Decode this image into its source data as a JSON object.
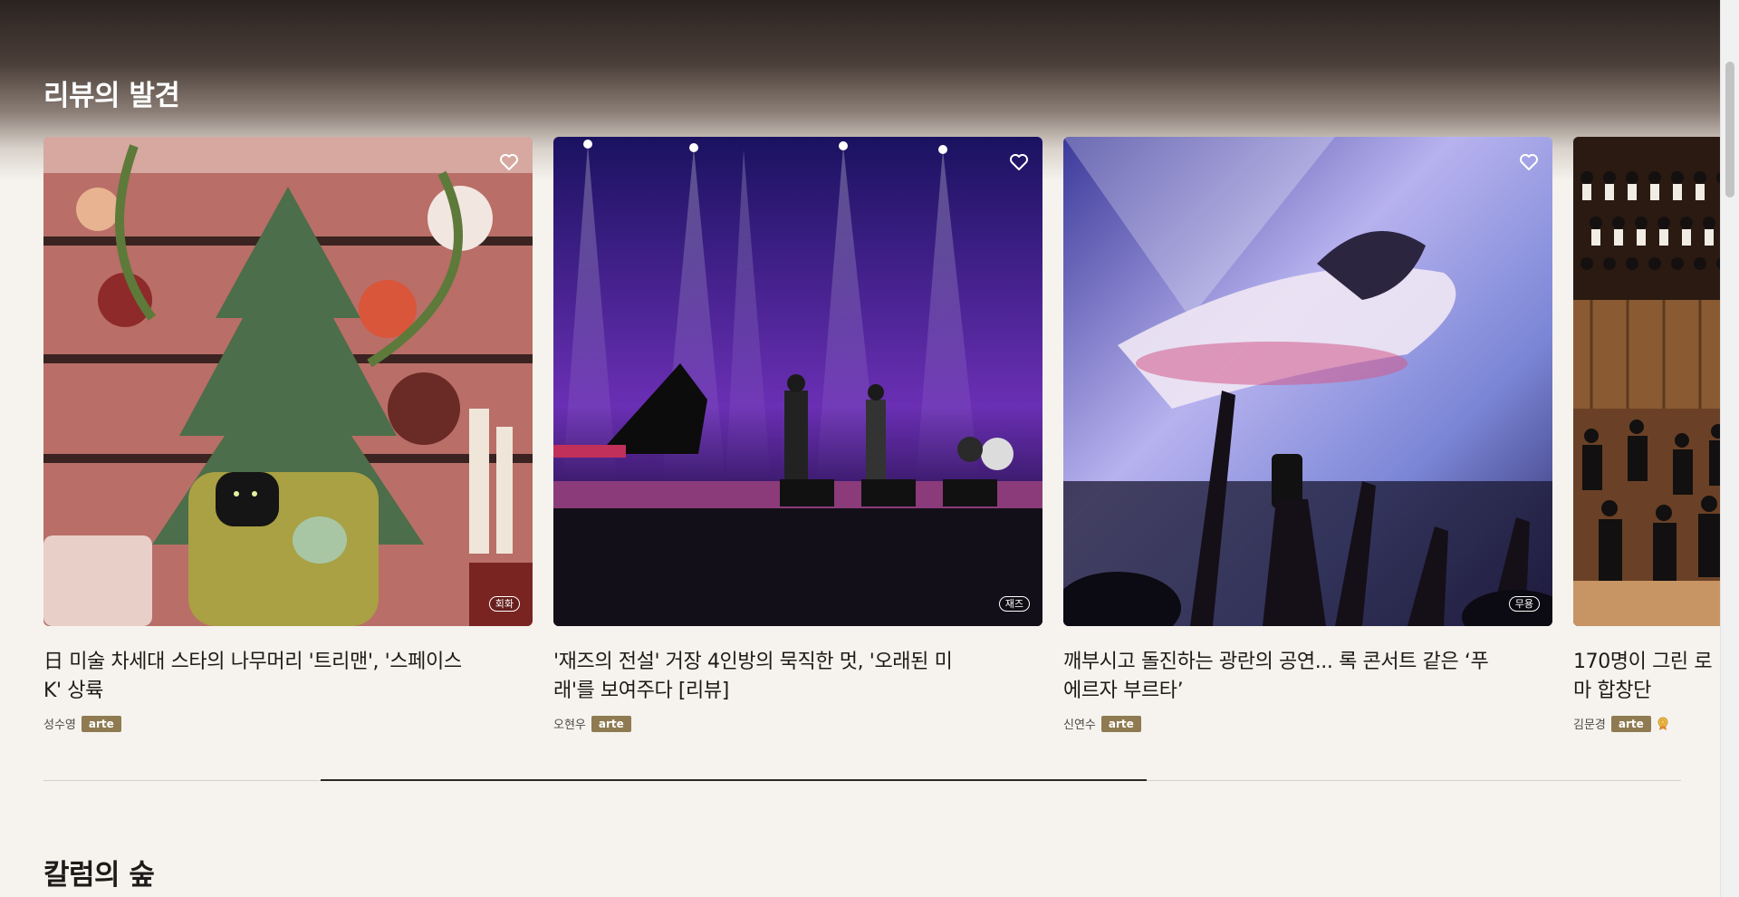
{
  "sections": {
    "review_title": "리뷰의 발견",
    "column_title": "칼럼의 숲"
  },
  "cards": [
    {
      "title": "日 미술 차세대 스타의 나무머리 '트리맨', '스페이스 K' 상륙",
      "author": "성수영",
      "publisher": "arte",
      "genre": "회화"
    },
    {
      "title": "'재즈의 전설' 거장 4인방의 묵직한 멋, '오래된 미래'를 보여주다 [리뷰]",
      "author": "오현우",
      "publisher": "arte",
      "genre": "재즈"
    },
    {
      "title": "깨부시고 돌진하는 광란의 공연... 록 콘서트 같은 ‘푸에르자 부르타’",
      "author": "신연수",
      "publisher": "arte",
      "genre": "무용"
    },
    {
      "title": "170명이 그린 로마 합창단",
      "author": "김문경",
      "publisher": "arte",
      "genre": ""
    }
  ],
  "icons": {
    "like": "heart-outline-icon",
    "award": "award-medal-icon"
  },
  "colors": {
    "publisher_badge": "#8f7a52",
    "page_background": "#f6f3ee"
  }
}
